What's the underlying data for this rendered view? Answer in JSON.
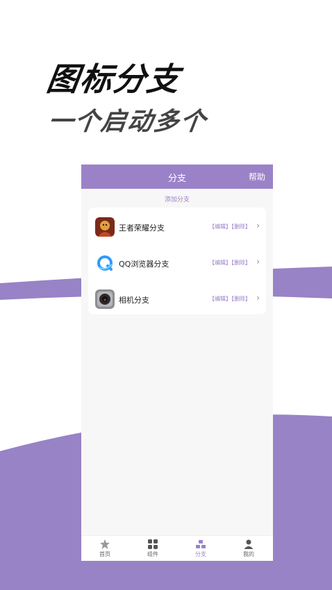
{
  "headline": {
    "line1": "图标分支",
    "line2": "一个启动多个"
  },
  "colors": {
    "accent": "#9b82c8",
    "wave": "#9783c5"
  },
  "phone": {
    "topbar": {
      "title": "分支",
      "help": "帮助"
    },
    "add_branch_label": "添加分支",
    "branches": [
      {
        "name": "王者荣耀分支",
        "icon": "honor-of-kings-app-icon",
        "edit": "【编辑】",
        "delete": "【删除】"
      },
      {
        "name": "QQ浏览器分支",
        "icon": "qq-browser-app-icon",
        "edit": "【编辑】",
        "delete": "【删除】"
      },
      {
        "name": "相机分支",
        "icon": "camera-app-icon",
        "edit": "【编辑】",
        "delete": "【删除】"
      }
    ],
    "tabs": [
      {
        "label": "首页",
        "icon": "star-icon"
      },
      {
        "label": "组件",
        "icon": "grid-icon"
      },
      {
        "label": "分支",
        "icon": "branch-icon",
        "active": true
      },
      {
        "label": "我的",
        "icon": "person-icon"
      }
    ]
  }
}
